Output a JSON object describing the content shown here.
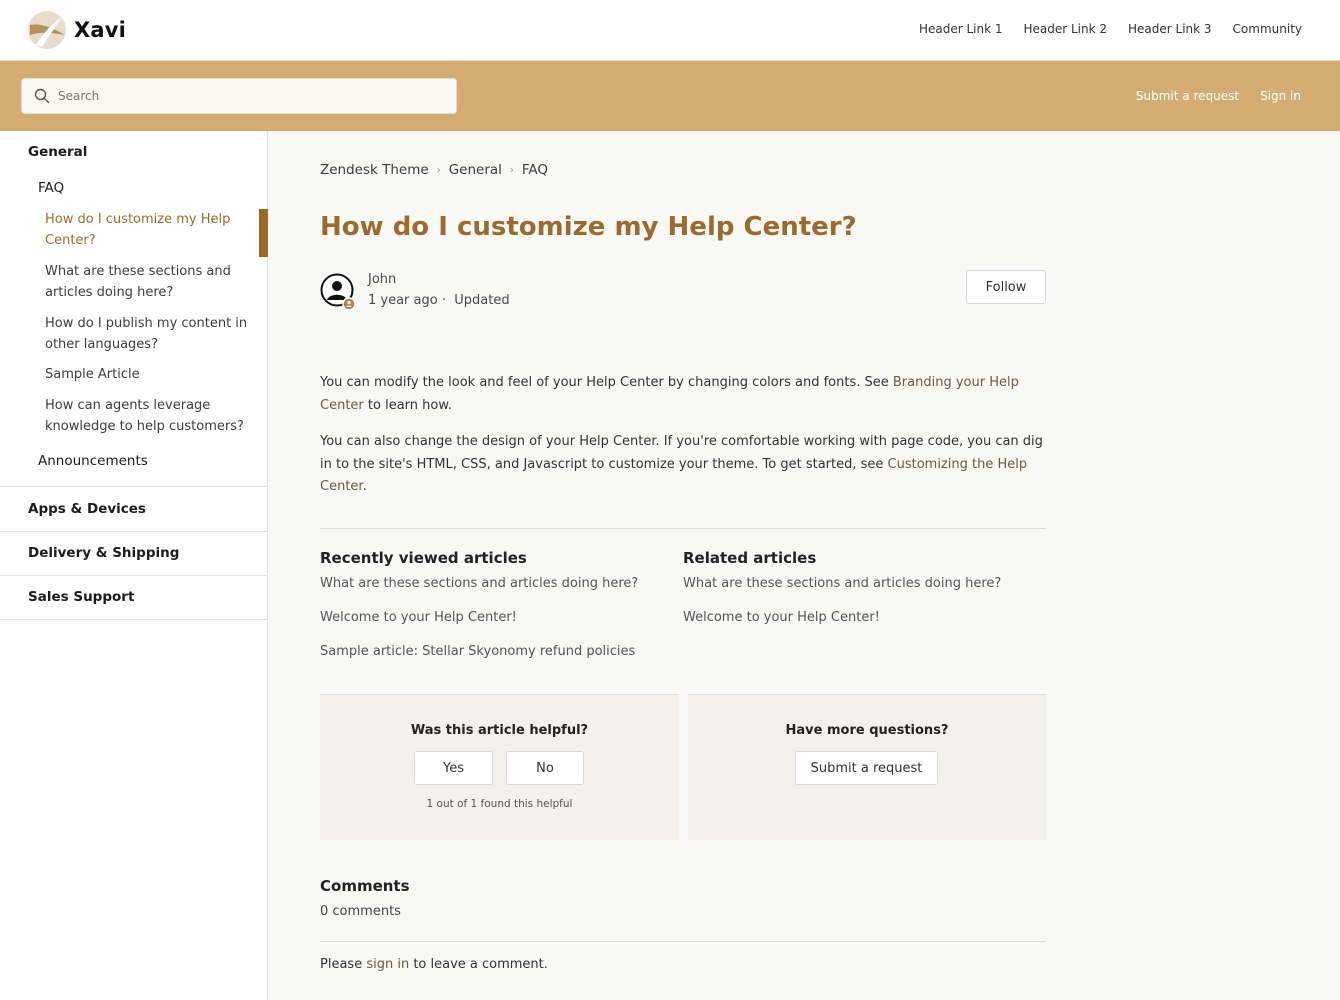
{
  "brand": {
    "name": "Xavi"
  },
  "header": {
    "links": [
      "Header Link 1",
      "Header Link 2",
      "Header Link 3",
      "Community"
    ]
  },
  "search": {
    "placeholder": "Search"
  },
  "band_links": {
    "submit_request": "Submit a request",
    "sign_in": "Sign in"
  },
  "sidebar": {
    "category": "General",
    "section": "FAQ",
    "articles": [
      "How do I customize my Help Center?",
      "What are these sections and articles doing here?",
      "How do I publish my content in other languages?",
      "Sample Article",
      "How can agents leverage knowledge to help customers?"
    ],
    "section2": "Announcements",
    "other_categories": [
      "Apps & Devices",
      "Delivery & Shipping",
      "Sales Support"
    ]
  },
  "breadcrumbs": [
    "Zendesk Theme",
    "General",
    "FAQ"
  ],
  "breadcrumb_separator": "›",
  "article": {
    "title": "How do I customize my Help Center?",
    "author": "John",
    "time": "1 year ago",
    "updated": "Updated",
    "follow_label": "Follow",
    "p1_before": "You can modify the look and feel of your Help Center by changing colors and fonts. See ",
    "p1_link": "Branding your Help Center",
    "p1_after": " to learn how.",
    "p2_before": "You can also change the design of your Help Center. If you're comfortable working with page code, you can dig in to the site's HTML, CSS, and Javascript to customize your theme. To get started, see ",
    "p2_link": "Customizing the Help Center",
    "p2_after": "."
  },
  "recently_viewed": {
    "heading": "Recently viewed articles",
    "items": [
      "What are these sections and articles doing here?",
      "Welcome to your Help Center!",
      "Sample article: Stellar Skyonomy refund policies"
    ]
  },
  "related": {
    "heading": "Related articles",
    "items": [
      "What are these sections and articles doing here?",
      "Welcome to your Help Center!"
    ]
  },
  "helpful": {
    "question": "Was this article helpful?",
    "yes": "Yes",
    "no": "No",
    "count_text": "1 out of 1 found this helpful"
  },
  "more_questions": {
    "heading": "Have more questions?",
    "button": "Submit a request"
  },
  "comments": {
    "heading": "Comments",
    "count": "0 comments",
    "prompt_before": "Please ",
    "prompt_link": "sign in",
    "prompt_after": " to leave a comment."
  },
  "colors": {
    "accent": "#9c6b2c",
    "band": "#d2ac73",
    "panel": "#f4f1ec"
  }
}
